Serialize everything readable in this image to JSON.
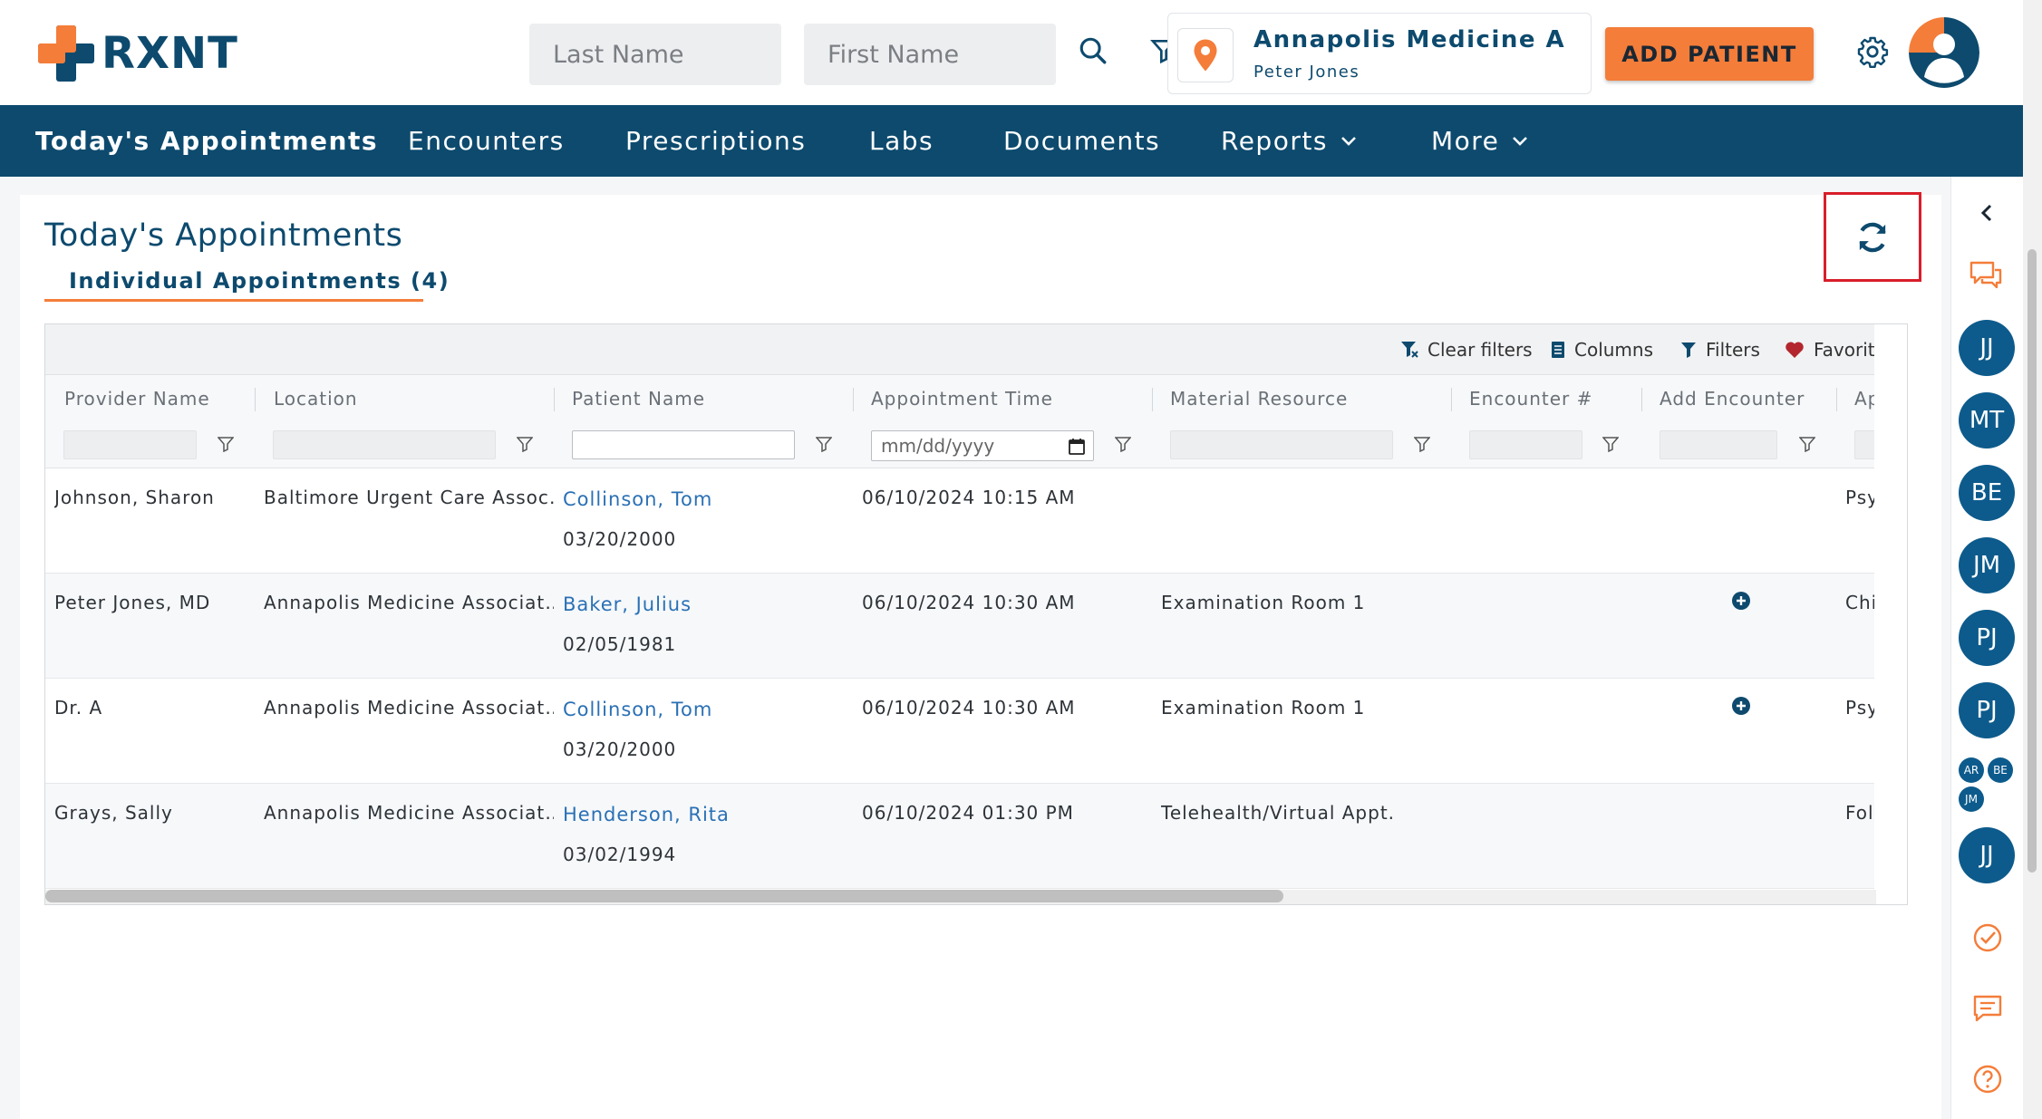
{
  "brand": {
    "name": "RXNT"
  },
  "header": {
    "last_name_placeholder": "Last Name",
    "first_name_placeholder": "First Name",
    "location_name": "Annapolis Medicine A",
    "location_user": "Peter Jones",
    "add_patient_label": "ADD PATIENT"
  },
  "nav": {
    "todays": "Today's Appointments",
    "encounters": "Encounters",
    "prescriptions": "Prescriptions",
    "labs": "Labs",
    "documents": "Documents",
    "reports": "Reports",
    "more": "More"
  },
  "page": {
    "title": "Today's Appointments",
    "tab_label": "Individual Appointments (4)"
  },
  "toolbar": {
    "clear_filters": "Clear filters",
    "columns": "Columns",
    "filters": "Filters",
    "favorites": "Favorites"
  },
  "grid": {
    "columns": [
      "Provider Name",
      "Location",
      "Patient Name",
      "Appointment Time",
      "Material Resource",
      "Encounter #",
      "Add Encounter",
      "Ap"
    ],
    "date_placeholder": "mm/dd/yyyy",
    "rows": [
      {
        "provider": "Johnson, Sharon",
        "location": "Baltimore Urgent Care Assoc…",
        "patient": "Collinson, Tom",
        "dob": "03/20/2000",
        "time": "06/10/2024 10:15 AM",
        "resource": "",
        "type": "Psy"
      },
      {
        "provider": "Peter Jones, MD",
        "location": "Annapolis Medicine Associat…",
        "patient": "Baker, Julius",
        "dob": "02/05/1981",
        "time": "06/10/2024 10:30 AM",
        "resource": "Examination Room 1",
        "type": "Chi"
      },
      {
        "provider": "Dr. A",
        "location": "Annapolis Medicine Associat…",
        "patient": "Collinson, Tom",
        "dob": "03/20/2000",
        "time": "06/10/2024 10:30 AM",
        "resource": "Examination Room 1",
        "type": "Psy"
      },
      {
        "provider": "Grays, Sally",
        "location": "Annapolis Medicine Associat…",
        "patient": "Henderson, Rita",
        "dob": "03/02/1994",
        "time": "06/10/2024 01:30 PM",
        "resource": "Telehealth/Virtual Appt.",
        "type": "Foll"
      }
    ]
  },
  "rail": {
    "avatars": [
      "JJ",
      "MT",
      "BE",
      "JM",
      "PJ",
      "PJ"
    ],
    "mini_avatars": [
      "AR",
      "BE",
      "JM"
    ],
    "last_avatar": "JJ"
  },
  "colors": {
    "brand_navy": "#0d4a6e",
    "brand_orange": "#f47d3a",
    "link_blue": "#2a70b5",
    "highlight_red": "#d81e2a"
  },
  "icons": [
    "search-icon",
    "filter-icon",
    "location-pin-icon",
    "gear-icon",
    "user-avatar-icon",
    "chevron-down-icon",
    "refresh-icon",
    "clear-filter-icon",
    "columns-icon",
    "heart-icon",
    "calendar-icon",
    "add-circle-icon",
    "chevron-left-icon",
    "chat-icon",
    "check-circle-icon",
    "message-icon",
    "help-icon"
  ]
}
